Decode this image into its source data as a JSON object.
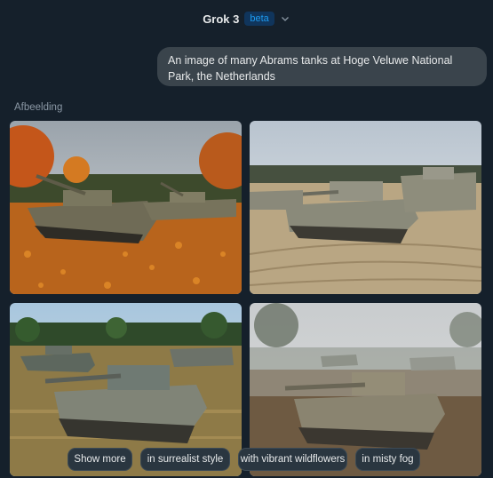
{
  "header": {
    "title": "Grok 3",
    "badge": "beta"
  },
  "prompt": {
    "text": "An image of many Abrams tanks at Hoge Veluwe National Park, the Netherlands"
  },
  "section": {
    "label": "Afbeelding"
  },
  "images": [
    {
      "name": "generated-image-1",
      "scene": "autumn forest with orange leaves"
    },
    {
      "name": "generated-image-2",
      "scene": "sandy dirt tracks"
    },
    {
      "name": "generated-image-3",
      "scene": "heath field with trees"
    },
    {
      "name": "generated-image-4",
      "scene": "misty fog forest"
    }
  ],
  "suggestions": [
    "Show more",
    "in surrealist style",
    "with vibrant wildflowers",
    "in misty fog"
  ],
  "colors": {
    "background": "#15202b",
    "badge_text": "#1d9bf0",
    "chip_bg": "#2a3640"
  }
}
